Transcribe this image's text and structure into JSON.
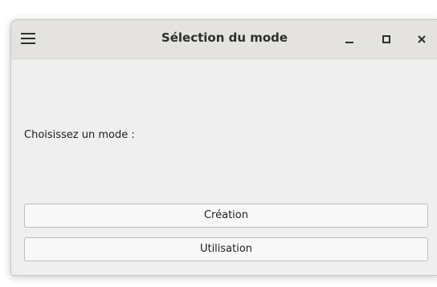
{
  "window": {
    "title": "Sélection du mode"
  },
  "titlebar": {
    "menu_icon": "hamburger-menu-icon",
    "minimize_icon": "minimize-icon",
    "maximize_icon": "maximize-icon",
    "close_icon": "close-icon"
  },
  "content": {
    "prompt": "Choisissez un mode :",
    "buttons": [
      {
        "label": "Création"
      },
      {
        "label": "Utilisation"
      }
    ]
  }
}
